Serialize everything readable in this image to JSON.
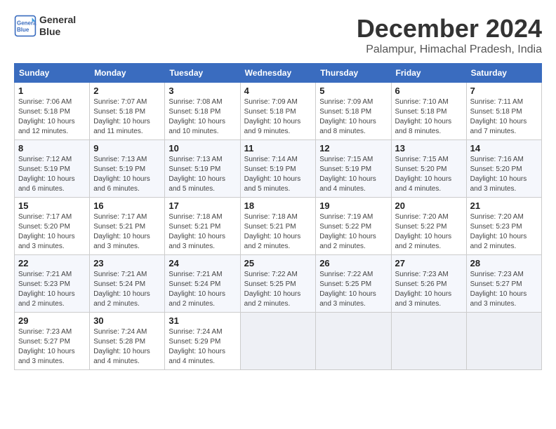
{
  "logo": {
    "text_line1": "General",
    "text_line2": "Blue"
  },
  "header": {
    "month_year": "December 2024",
    "location": "Palampur, Himachal Pradesh, India"
  },
  "days_of_week": [
    "Sunday",
    "Monday",
    "Tuesday",
    "Wednesday",
    "Thursday",
    "Friday",
    "Saturday"
  ],
  "weeks": [
    [
      {
        "day": "1",
        "sunrise": "7:06 AM",
        "sunset": "5:18 PM",
        "daylight": "10 hours and 12 minutes."
      },
      {
        "day": "2",
        "sunrise": "7:07 AM",
        "sunset": "5:18 PM",
        "daylight": "10 hours and 11 minutes."
      },
      {
        "day": "3",
        "sunrise": "7:08 AM",
        "sunset": "5:18 PM",
        "daylight": "10 hours and 10 minutes."
      },
      {
        "day": "4",
        "sunrise": "7:09 AM",
        "sunset": "5:18 PM",
        "daylight": "10 hours and 9 minutes."
      },
      {
        "day": "5",
        "sunrise": "7:09 AM",
        "sunset": "5:18 PM",
        "daylight": "10 hours and 8 minutes."
      },
      {
        "day": "6",
        "sunrise": "7:10 AM",
        "sunset": "5:18 PM",
        "daylight": "10 hours and 8 minutes."
      },
      {
        "day": "7",
        "sunrise": "7:11 AM",
        "sunset": "5:18 PM",
        "daylight": "10 hours and 7 minutes."
      }
    ],
    [
      {
        "day": "8",
        "sunrise": "7:12 AM",
        "sunset": "5:19 PM",
        "daylight": "10 hours and 6 minutes."
      },
      {
        "day": "9",
        "sunrise": "7:13 AM",
        "sunset": "5:19 PM",
        "daylight": "10 hours and 6 minutes."
      },
      {
        "day": "10",
        "sunrise": "7:13 AM",
        "sunset": "5:19 PM",
        "daylight": "10 hours and 5 minutes."
      },
      {
        "day": "11",
        "sunrise": "7:14 AM",
        "sunset": "5:19 PM",
        "daylight": "10 hours and 5 minutes."
      },
      {
        "day": "12",
        "sunrise": "7:15 AM",
        "sunset": "5:19 PM",
        "daylight": "10 hours and 4 minutes."
      },
      {
        "day": "13",
        "sunrise": "7:15 AM",
        "sunset": "5:20 PM",
        "daylight": "10 hours and 4 minutes."
      },
      {
        "day": "14",
        "sunrise": "7:16 AM",
        "sunset": "5:20 PM",
        "daylight": "10 hours and 3 minutes."
      }
    ],
    [
      {
        "day": "15",
        "sunrise": "7:17 AM",
        "sunset": "5:20 PM",
        "daylight": "10 hours and 3 minutes."
      },
      {
        "day": "16",
        "sunrise": "7:17 AM",
        "sunset": "5:21 PM",
        "daylight": "10 hours and 3 minutes."
      },
      {
        "day": "17",
        "sunrise": "7:18 AM",
        "sunset": "5:21 PM",
        "daylight": "10 hours and 3 minutes."
      },
      {
        "day": "18",
        "sunrise": "7:18 AM",
        "sunset": "5:21 PM",
        "daylight": "10 hours and 2 minutes."
      },
      {
        "day": "19",
        "sunrise": "7:19 AM",
        "sunset": "5:22 PM",
        "daylight": "10 hours and 2 minutes."
      },
      {
        "day": "20",
        "sunrise": "7:20 AM",
        "sunset": "5:22 PM",
        "daylight": "10 hours and 2 minutes."
      },
      {
        "day": "21",
        "sunrise": "7:20 AM",
        "sunset": "5:23 PM",
        "daylight": "10 hours and 2 minutes."
      }
    ],
    [
      {
        "day": "22",
        "sunrise": "7:21 AM",
        "sunset": "5:23 PM",
        "daylight": "10 hours and 2 minutes."
      },
      {
        "day": "23",
        "sunrise": "7:21 AM",
        "sunset": "5:24 PM",
        "daylight": "10 hours and 2 minutes."
      },
      {
        "day": "24",
        "sunrise": "7:21 AM",
        "sunset": "5:24 PM",
        "daylight": "10 hours and 2 minutes."
      },
      {
        "day": "25",
        "sunrise": "7:22 AM",
        "sunset": "5:25 PM",
        "daylight": "10 hours and 2 minutes."
      },
      {
        "day": "26",
        "sunrise": "7:22 AM",
        "sunset": "5:25 PM",
        "daylight": "10 hours and 3 minutes."
      },
      {
        "day": "27",
        "sunrise": "7:23 AM",
        "sunset": "5:26 PM",
        "daylight": "10 hours and 3 minutes."
      },
      {
        "day": "28",
        "sunrise": "7:23 AM",
        "sunset": "5:27 PM",
        "daylight": "10 hours and 3 minutes."
      }
    ],
    [
      {
        "day": "29",
        "sunrise": "7:23 AM",
        "sunset": "5:27 PM",
        "daylight": "10 hours and 3 minutes."
      },
      {
        "day": "30",
        "sunrise": "7:24 AM",
        "sunset": "5:28 PM",
        "daylight": "10 hours and 4 minutes."
      },
      {
        "day": "31",
        "sunrise": "7:24 AM",
        "sunset": "5:29 PM",
        "daylight": "10 hours and 4 minutes."
      },
      null,
      null,
      null,
      null
    ]
  ]
}
